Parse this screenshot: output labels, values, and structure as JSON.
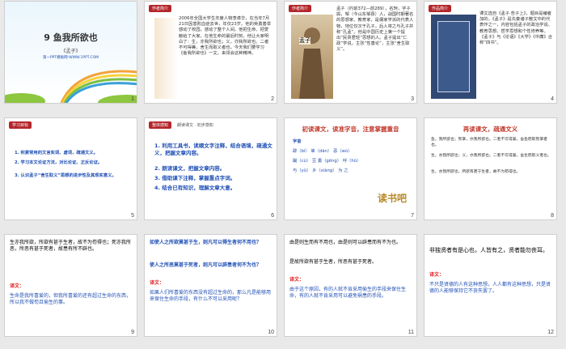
{
  "slides": [
    {
      "num": "1",
      "title": "9 鱼我所欲也",
      "author": "《孟子》",
      "site": "第一PPT模板网-WWW.1PPT.COM"
    },
    {
      "num": "2",
      "tag": "作者简介",
      "body": "2006年全国大学生年度人物李卓华，在当年7月21日因患败血症去世，年仅23岁。他的英勇善举感动了校园，感动了整个人间。他把生命、把爱献给了大家。在他生命的最后时刻，他让大家明白了：生，亦我所欲也；义，亦我所欲也。二者不可得兼，舍生而取义者也。今天我们要学习《鱼我所欲也》一文，来领会这种精神。"
    },
    {
      "num": "3",
      "tag": "作者简介",
      "body": "孟子（约前372—前289），名轲，字子舆，邹（今山东邹县）人，战国时期著名的思想家、教育家，是儒家学派的代表人物，地位仅次于孔子，后人将之与孔子并称“孔孟”。他是中国历史上第一个提出“民贵君轻”思想的人。孟子提出“仁政”学说，主张“性善论”，主张“舍生取义”。",
      "nameplate": "孟子"
    },
    {
      "num": "4",
      "tag": "作品简介",
      "body": "课文选自《孟子·告子上》，题目是编者加的。《孟子》是先秦诸子散文中的代表作之一，内容包括孟子的政治学说、教育思想、哲学思想和个性修养等。《孟子》与《论语》《大学》《中庸》合称“四书”。"
    },
    {
      "num": "5",
      "tag": "学习目标",
      "items": [
        "1. 积累常用的文言实词、虚词，疏通文义。",
        "2. 学习本文论证方法，对比论证、正反论证。",
        "3. 认识孟子“舍生取义”思想的进步性及其现实意义。"
      ]
    },
    {
      "num": "6",
      "tag": "整体感知",
      "subtag": "朗读课文 · 初步感知",
      "items": [
        "1. 利用工具书，读顺文字注释，结合语境，疏通文义，把握文章内容。",
        "2. 朗读课文，把握文章内容。",
        "3. 借助课下注释，掌握重点字词。",
        "4. 结合已有知识，理解文章大意。"
      ]
    },
    {
      "num": "7",
      "title": "初读课文，读准字音，注意掌握重音",
      "lines": [
        "字音",
        "辟（bì）     箪（dān）     恶（wù）",
        "蹴（cù）     豆  羹（gēng）   呼（hū）",
        "与（yǔ）     乡（xiàng）   为  之"
      ],
      "logo": "读书吧"
    },
    {
      "num": "8",
      "title": "再读课文，疏通文义",
      "lines": [
        "鱼，我所欲也；熊掌，亦我所欲也。二者不可得兼，舍鱼而取熊掌者也。",
        "生，亦我所欲也；义，亦我所欲也。二者不可得兼，舍生而取义者也。",
        "生，亦我所欲也，所欲有甚于生者，故不为苟得也。"
      ]
    },
    {
      "num": "9",
      "lines": [
        "生亦我所欲，所欲有甚于生者，故不为苟得也；死亦我所恶，所恶有甚于死者，故患有所不辟也。",
        "译文：",
        "生命是我所喜爱的，但我所喜爱的还有超过生命的东西，所以我不做苟且偷生的事。"
      ]
    },
    {
      "num": "10",
      "lines": [
        "如使人之所欲莫甚于生，则凡可以得生者何不用也？",
        "使人之所恶莫甚于死者，则凡可以辟患者何不为也？",
        "译文：",
        "如果人们所喜爱的东西没有超过生命的，那么凡是能够用来保住生命的手段，有什么不可以采用呢？"
      ]
    },
    {
      "num": "11",
      "lines": [
        "由是则生而有不用也，由是则可以辟患而有不为也。",
        "是故所欲有甚于生者，所恶有甚于死者。",
        "译文：",
        "由于这个原因，有的人就不肯采用偷生的手段来保住生命，有的人就不肯采用可以避免祸患的手段。"
      ]
    },
    {
      "num": "12",
      "lines": [
        "非独贤者有是心也，人皆有之，贤者能勿丧耳。",
        "译文：",
        "不只是贤德的人有这种思想，人人都有这种思想，只是贤德的人能够保持它不丧失罢了。"
      ]
    }
  ]
}
